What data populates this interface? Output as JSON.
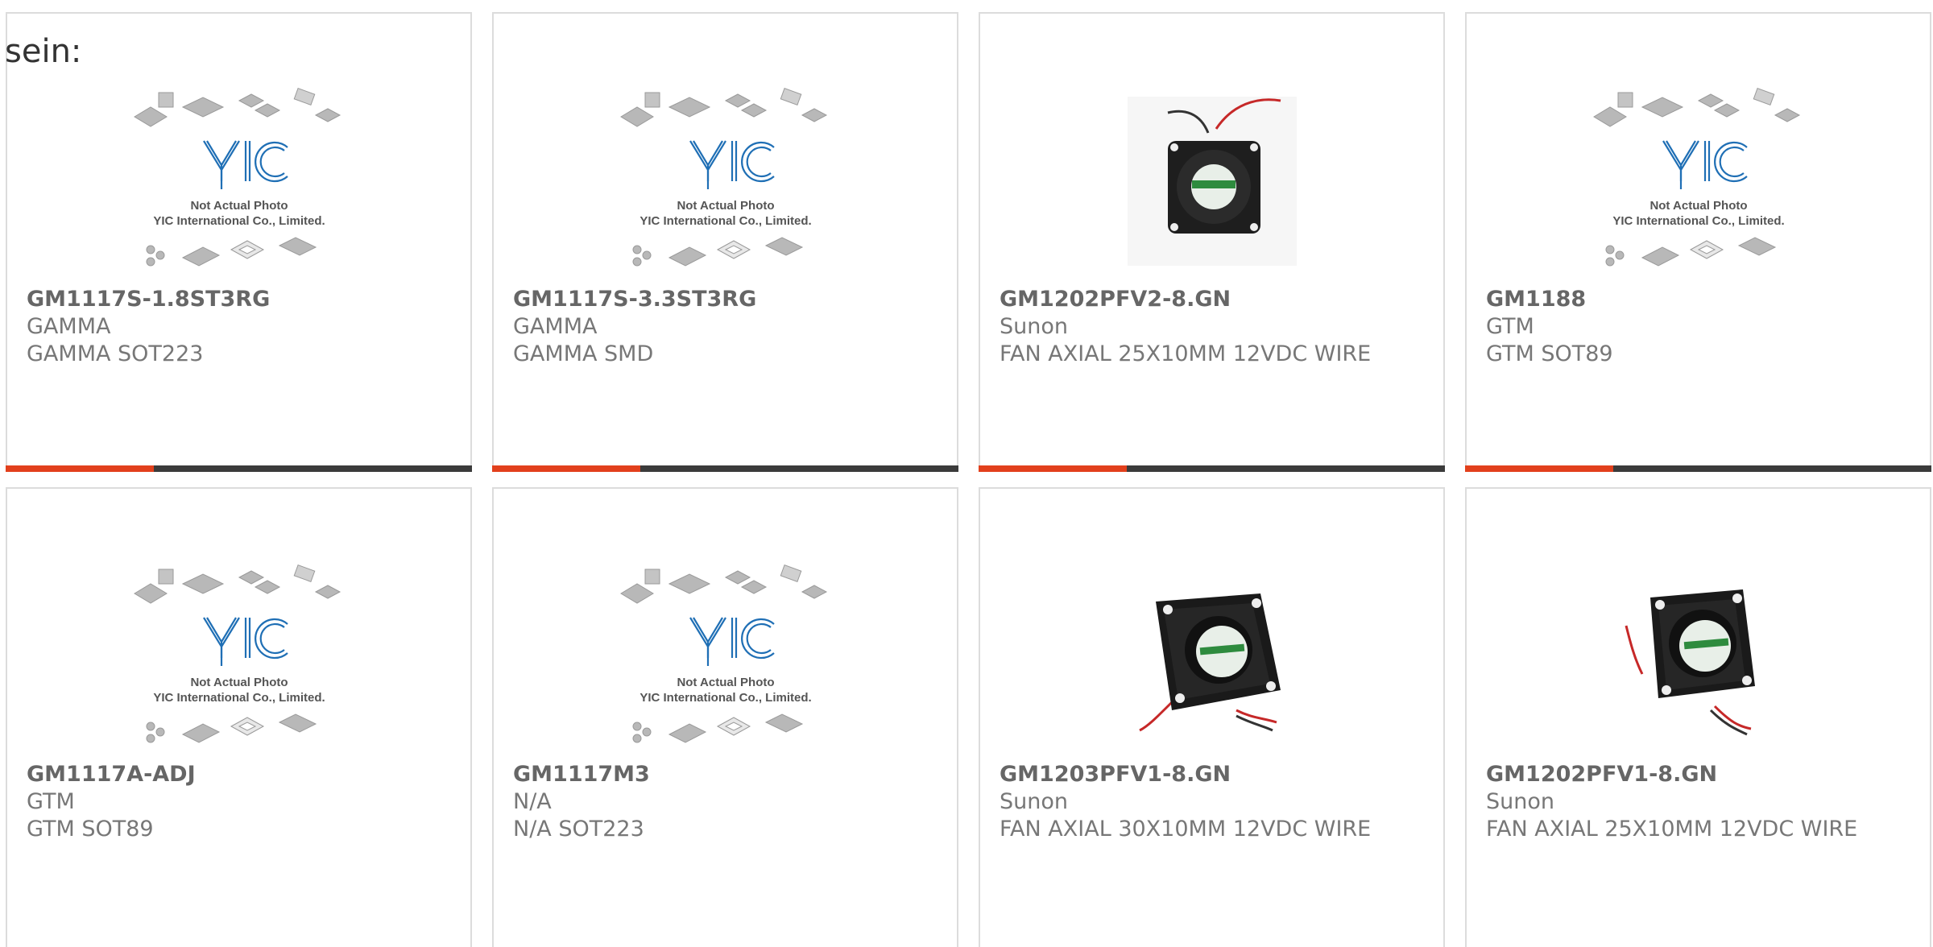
{
  "top_fragment": "sein:",
  "products": [
    {
      "part_number": "GM1117S-1.8ST3RG",
      "manufacturer": "GAMMA",
      "description": "GAMMA SOT223",
      "image": "yic-placeholder",
      "photo_caption_1": "Not Actual Photo",
      "photo_caption_2": "YIC International Co., Limited."
    },
    {
      "part_number": "GM1117S-3.3ST3RG",
      "manufacturer": "GAMMA",
      "description": "GAMMA SMD",
      "image": "yic-placeholder",
      "photo_caption_1": "Not Actual Photo",
      "photo_caption_2": "YIC International Co., Limited."
    },
    {
      "part_number": "GM1202PFV2-8.GN",
      "manufacturer": "Sunon",
      "description": "FAN AXIAL 25X10MM 12VDC WIRE",
      "image": "fan-photo"
    },
    {
      "part_number": "GM1188",
      "manufacturer": "GTM",
      "description": "GTM SOT89",
      "image": "yic-placeholder",
      "photo_caption_1": "Not Actual Photo",
      "photo_caption_2": "YIC International Co., Limited."
    },
    {
      "part_number": "GM1117A-ADJ",
      "manufacturer": "GTM",
      "description": "GTM SOT89",
      "image": "yic-placeholder",
      "photo_caption_1": "Not Actual Photo",
      "photo_caption_2": "YIC International Co., Limited."
    },
    {
      "part_number": "GM1117M3",
      "manufacturer": "N/A",
      "description": "N/A SOT223",
      "image": "yic-placeholder",
      "photo_caption_1": "Not Actual Photo",
      "photo_caption_2": "YIC International Co., Limited."
    },
    {
      "part_number": "GM1203PFV1-8.GN",
      "manufacturer": "Sunon",
      "description": "FAN AXIAL 30X10MM 12VDC WIRE",
      "image": "fan-photo"
    },
    {
      "part_number": "GM1202PFV1-8.GN",
      "manufacturer": "Sunon",
      "description": "FAN AXIAL 25X10MM 12VDC WIRE",
      "image": "fan-photo"
    }
  ],
  "colors": {
    "accent": "#e2401c",
    "bar": "#3b3b3b",
    "border": "#dcdcdc",
    "yic_blue": "#1f6fb5"
  }
}
